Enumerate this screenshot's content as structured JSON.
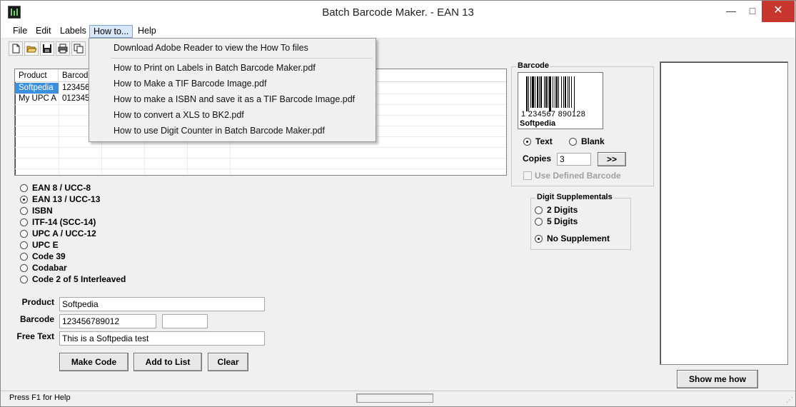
{
  "window": {
    "title": "Batch Barcode Maker.  - EAN 13",
    "minimize_glyph": "—",
    "maximize_glyph": "□",
    "close_glyph": "✕"
  },
  "menubar": {
    "items": [
      {
        "label": "File"
      },
      {
        "label": "Edit"
      },
      {
        "label": "Labels"
      },
      {
        "label": "How to..."
      },
      {
        "label": "Help"
      }
    ],
    "active": "How to..."
  },
  "toolbar": {
    "icons": [
      "new-document-icon",
      "open-folder-icon",
      "save-icon",
      "print-icon",
      "copy-icon"
    ]
  },
  "howto_menu": {
    "items": [
      "Download Adobe Reader to view the How To files",
      "How to Print on Labels in Batch Barcode Maker.pdf",
      "How to Make a TIF Barcode Image.pdf",
      "How to make a ISBN and save it as a TIF Barcode Image.pdf",
      "How to convert a XLS to BK2.pdf",
      "How to use Digit Counter in Batch Barcode Maker.pdf"
    ]
  },
  "list": {
    "columns": [
      "Product",
      "Barcode"
    ],
    "rows": [
      {
        "product": "Softpedia",
        "barcode": "123456",
        "selected": true
      },
      {
        "product": "My UPC A",
        "barcode": "012345",
        "selected": false
      }
    ]
  },
  "symbology": {
    "options": [
      {
        "label": "EAN 8 / UCC-8",
        "checked": false
      },
      {
        "label": "EAN 13 / UCC-13",
        "checked": true
      },
      {
        "label": "ISBN",
        "checked": false
      },
      {
        "label": "ITF-14 (SCC-14)",
        "checked": false
      },
      {
        "label": "UPC A / UCC-12",
        "checked": false
      },
      {
        "label": "UPC E",
        "checked": false
      },
      {
        "label": "Code 39",
        "checked": false
      },
      {
        "label": "Codabar",
        "checked": false
      },
      {
        "label": "Code 2 of 5 Interleaved",
        "checked": false
      }
    ]
  },
  "form": {
    "product_label": "Product",
    "product_value": "Softpedia",
    "barcode_label": "Barcode",
    "barcode_value": "123456789012",
    "barcode_extra_value": "",
    "freetext_label": "Free Text",
    "freetext_value": "This is a Softpedia test"
  },
  "buttons": {
    "make_code": "Make Code",
    "add_to_list": "Add to List",
    "clear": "Clear",
    "show_me_how": "Show me how",
    "next": ">>"
  },
  "barcode_panel": {
    "title": "Barcode",
    "digits": "1   234567   890128",
    "caption": "Softpedia",
    "text_option": "Text",
    "blank_option": "Blank",
    "text_checked": true,
    "copies_label": "Copies",
    "copies_value": "3",
    "use_defined_label": "Use Defined Barcode",
    "use_defined_checked": false
  },
  "supplementals": {
    "title": "Digit Supplementals",
    "options": [
      {
        "label": "2 Digits",
        "checked": false
      },
      {
        "label": "5 Digits",
        "checked": false
      },
      {
        "label": "No Supplement",
        "checked": true
      }
    ]
  },
  "statusbar": {
    "text": "Press F1 for Help"
  }
}
